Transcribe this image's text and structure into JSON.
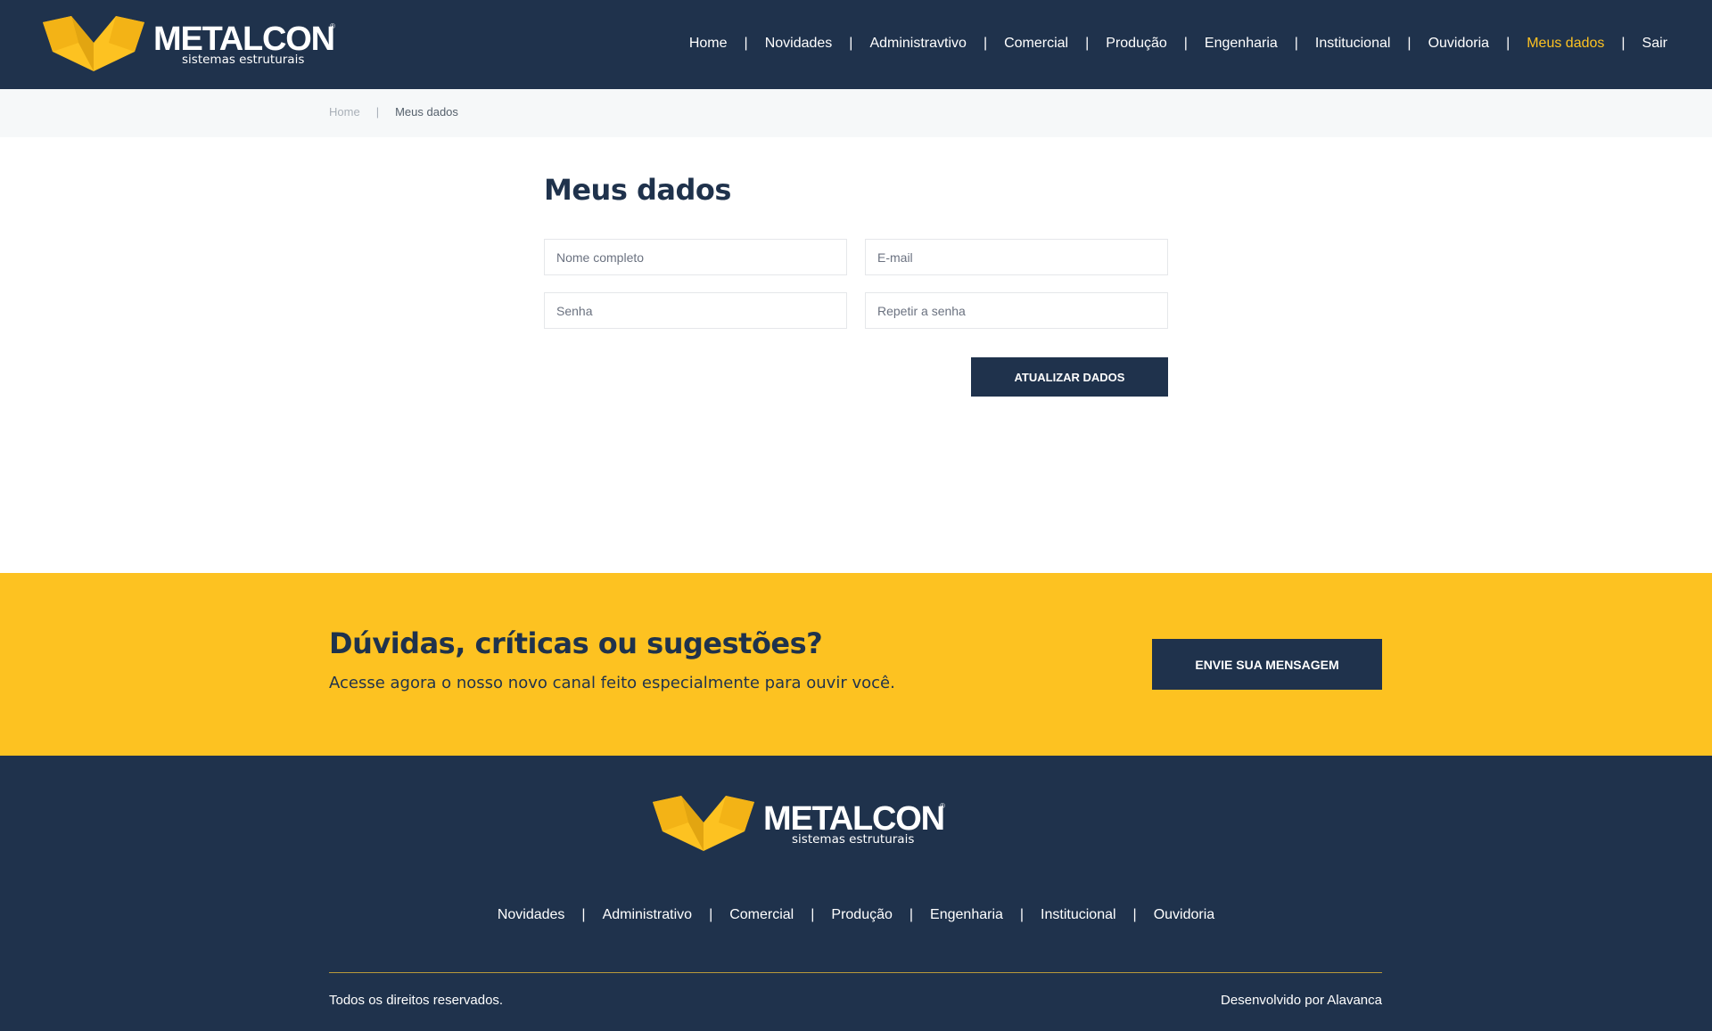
{
  "brand": {
    "name": "METALCON",
    "tagline": "sistemas estruturais",
    "registered": "®",
    "colors": {
      "navy": "#1f324c",
      "yellow": "#fdc221",
      "white": "#ffffff"
    },
    "logo_icon": "metalcon-m-icon"
  },
  "header": {
    "nav": [
      {
        "label": "Home"
      },
      {
        "label": "Novidades"
      },
      {
        "label": "Administravtivo"
      },
      {
        "label": "Comercial"
      },
      {
        "label": "Produção"
      },
      {
        "label": "Engenharia"
      },
      {
        "label": "Institucional"
      },
      {
        "label": "Ouvidoria"
      },
      {
        "label": "Meus dados",
        "active": true
      },
      {
        "label": "Sair"
      }
    ],
    "separator": "|"
  },
  "breadcrumb": {
    "home": "Home",
    "separator": "|",
    "current": "Meus dados"
  },
  "form": {
    "title": "Meus dados",
    "fields": {
      "name": {
        "placeholder": "Nome completo",
        "value": ""
      },
      "email": {
        "placeholder": "E-mail",
        "value": ""
      },
      "password": {
        "placeholder": "Senha",
        "value": ""
      },
      "password_repeat": {
        "placeholder": "Repetir a senha",
        "value": ""
      }
    },
    "submit_label": "ATUALIZAR DADOS"
  },
  "cta": {
    "title": "Dúvidas, críticas ou sugestões?",
    "subtitle": "Acesse agora o nosso novo canal feito especialmente para ouvir você.",
    "button_label": "ENVIE SUA MENSAGEM"
  },
  "footer": {
    "nav": [
      {
        "label": "Novidades"
      },
      {
        "label": "Administrativo"
      },
      {
        "label": "Comercial"
      },
      {
        "label": "Produção"
      },
      {
        "label": "Engenharia"
      },
      {
        "label": "Institucional"
      },
      {
        "label": "Ouvidoria"
      }
    ],
    "separator": "|",
    "copyright": "Todos os direitos reservados.",
    "developer": "Desenvolvido por Alavanca"
  }
}
